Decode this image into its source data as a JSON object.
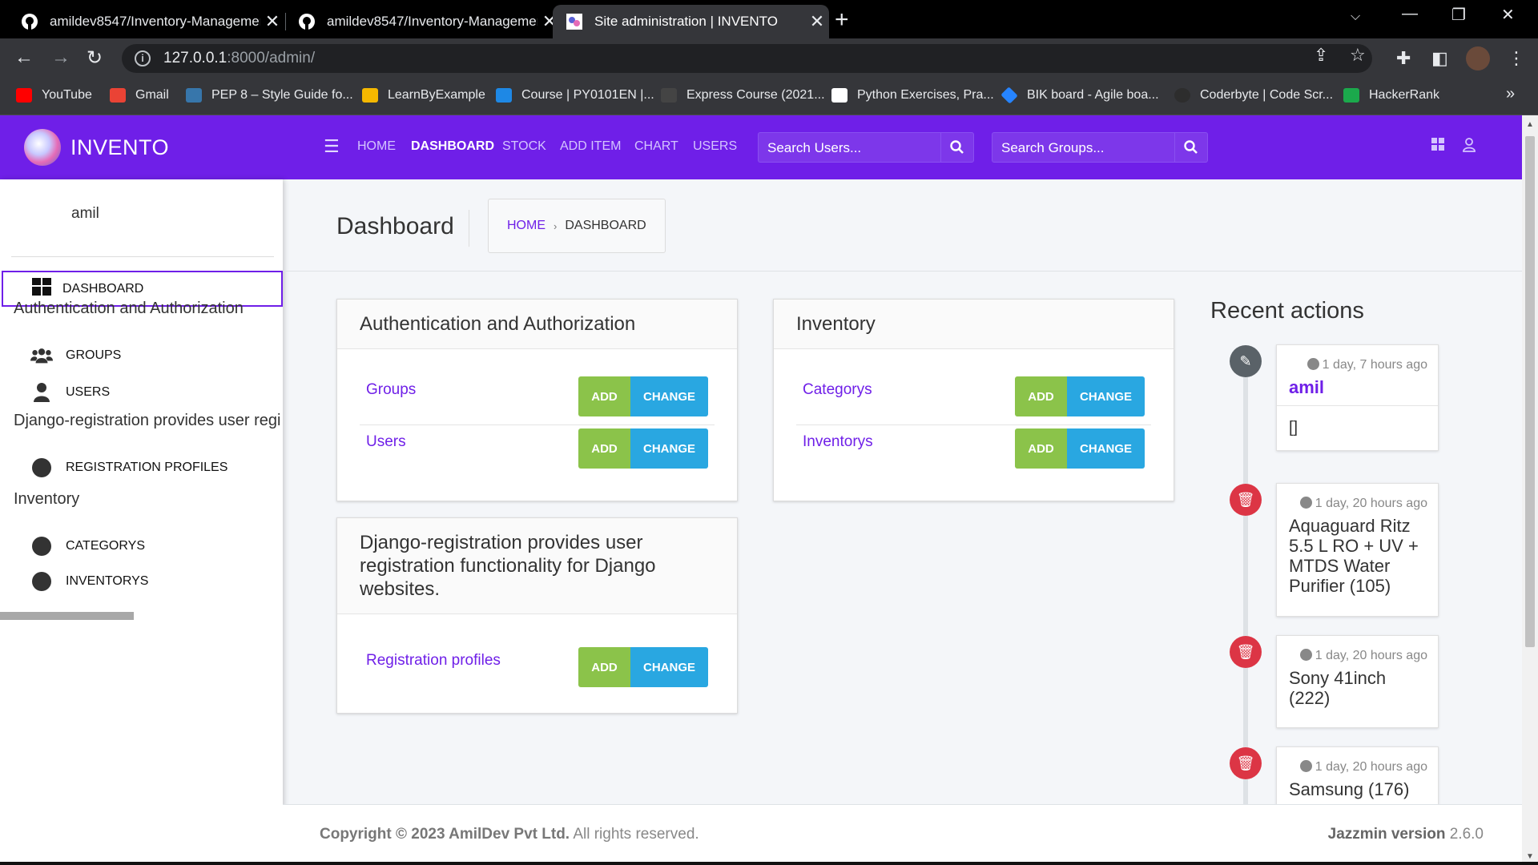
{
  "browser": {
    "tabs": [
      {
        "title": "amildev8547/Inventory-Managemer",
        "active": false
      },
      {
        "title": "amildev8547/Inventory-Managemer",
        "active": false
      },
      {
        "title": "Site administration | INVENTO",
        "active": true
      }
    ],
    "url_host": "127.0.0.1",
    "url_path": ":8000/admin/",
    "bookmarks": [
      {
        "label": "YouTube",
        "color": "#ff0000"
      },
      {
        "label": "Gmail",
        "color": "#ea4335"
      },
      {
        "label": "PEP 8 – Style Guide fo...",
        "color": "#3776ab"
      },
      {
        "label": "LearnByExample",
        "color": "#f5b800"
      },
      {
        "label": "Course | PY0101EN |...",
        "color": "#1e88e5"
      },
      {
        "label": "Express Course (2021...",
        "color": "#444444"
      },
      {
        "label": "Python Exercises, Pra...",
        "color": "#ffffff"
      },
      {
        "label": "BIK board - Agile boa...",
        "color": "#2684ff"
      },
      {
        "label": "Coderbyte | Code Scr...",
        "color": "#2d2d2d"
      },
      {
        "label": "HackerRank",
        "color": "#1ba94c"
      }
    ],
    "bookmarks_overflow": "»"
  },
  "brand": {
    "name": "INVENTO"
  },
  "topnav": {
    "links": [
      "HOME",
      "DASHBOARD",
      "STOCK",
      "ADD ITEM",
      "CHART",
      "USERS"
    ],
    "active": "DASHBOARD",
    "search_users_placeholder": "Search Users...",
    "search_groups_placeholder": "Search Groups..."
  },
  "sidebar": {
    "user": "amil",
    "dashboard_label": "DASHBOARD",
    "sections": [
      {
        "header": "Authentication and Authorization",
        "items": [
          "GROUPS",
          "USERS"
        ]
      },
      {
        "header": "Django-registration provides user regi",
        "items": [
          "REGISTRATION PROFILES"
        ]
      },
      {
        "header": "Inventory",
        "items": [
          "CATEGORYS",
          "INVENTORYS"
        ]
      }
    ]
  },
  "page": {
    "title": "Dashboard",
    "breadcrumb_home": "HOME",
    "breadcrumb_sep": "›",
    "breadcrumb_current": "DASHBOARD"
  },
  "buttons": {
    "add": "ADD",
    "change": "CHANGE"
  },
  "cards": {
    "auth": {
      "title": "Authentication and Authorization",
      "rows": [
        "Groups",
        "Users"
      ]
    },
    "inventory": {
      "title": "Inventory",
      "rows": [
        "Categorys",
        "Inventorys"
      ]
    },
    "registration": {
      "title": "Django-registration provides user registration functionality for Django websites.",
      "rows": [
        "Registration profiles"
      ]
    }
  },
  "recent_actions": {
    "title": "Recent actions",
    "items": [
      {
        "type": "edit",
        "time": "1 day, 7 hours ago",
        "name": "amil",
        "extra": "[]"
      },
      {
        "type": "delete",
        "time": "1 day, 20 hours ago",
        "name": "Aquaguard Ritz 5.5 L RO + UV + MTDS Water Purifier (105)"
      },
      {
        "type": "delete",
        "time": "1 day, 20 hours ago",
        "name": "Sony 41inch (222)"
      },
      {
        "type": "delete",
        "time": "1 day, 20 hours ago",
        "name": "Samsung (176)"
      }
    ]
  },
  "footer": {
    "copyright_bold": "Copyright © 2023 AmilDev Pvt Ltd.",
    "copyright_rest": " All rights reserved.",
    "version_bold": "Jazzmin version",
    "version_num": " 2.6.0"
  },
  "colors": {
    "primary": "#6f1fe8",
    "add": "#8bc34a",
    "change": "#29a7e1",
    "delete": "#dc3545"
  }
}
